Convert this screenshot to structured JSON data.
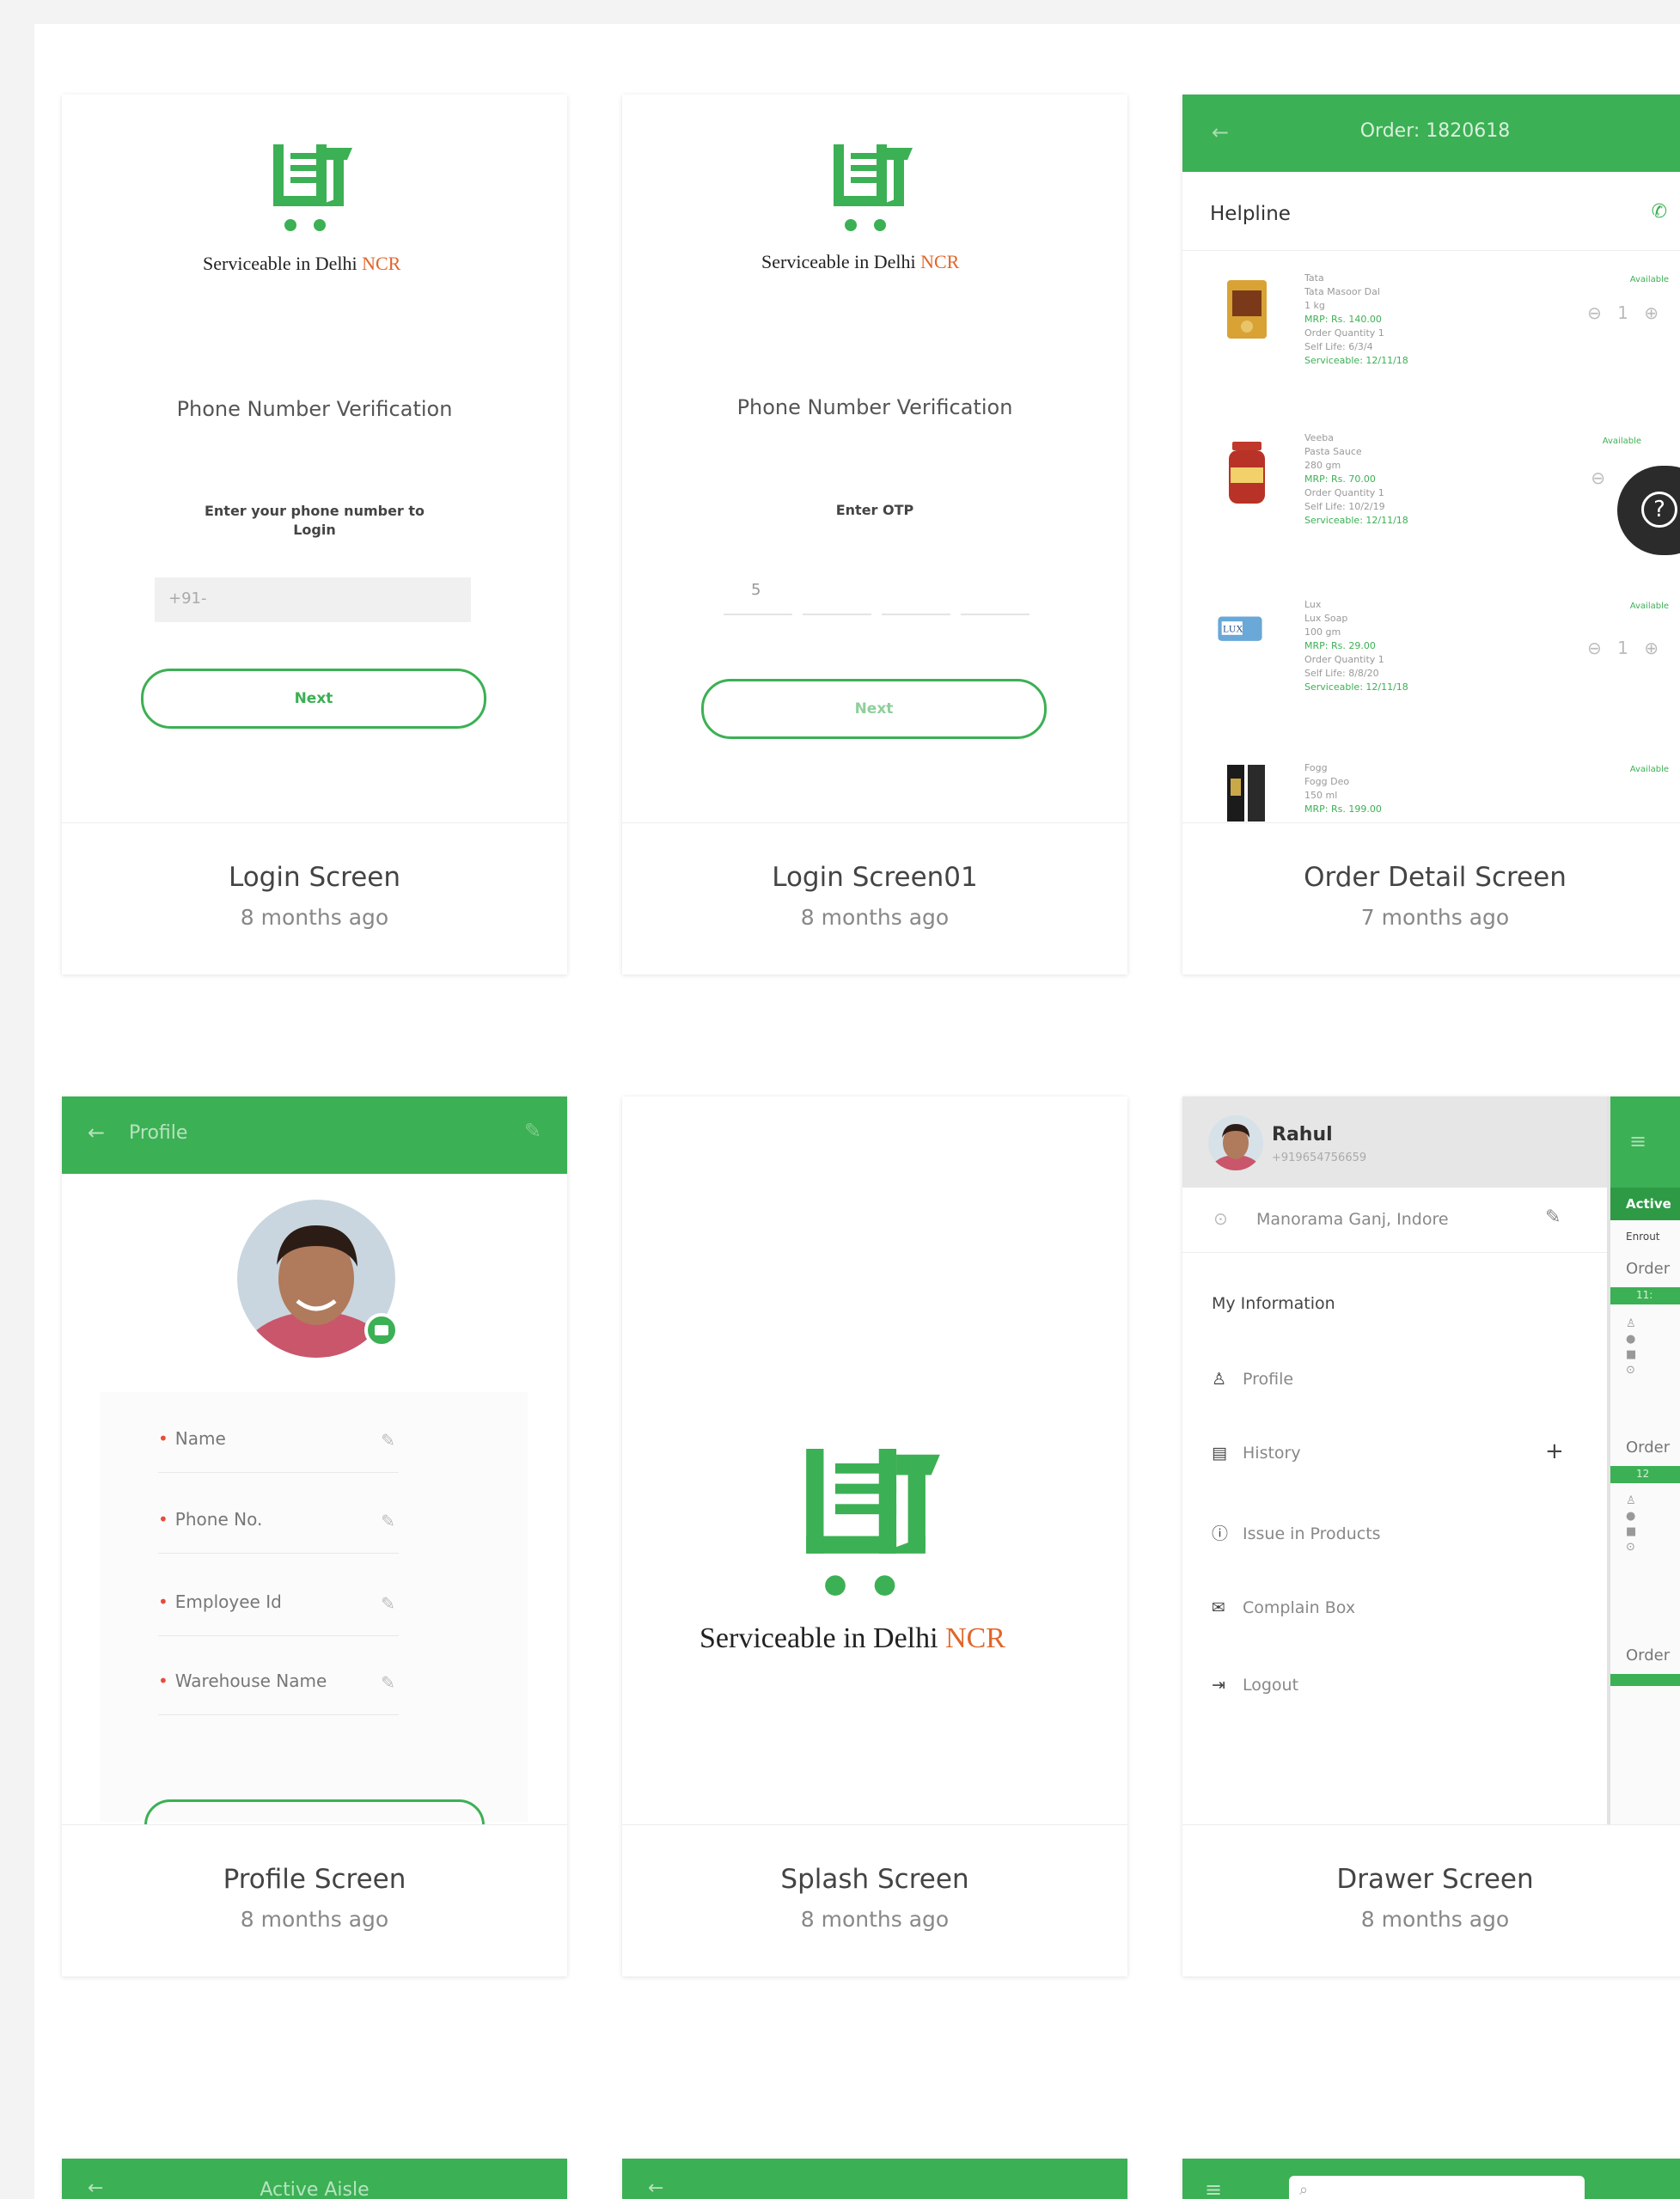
{
  "cards": [
    {
      "title": "Login Screen",
      "time": "8 months ago",
      "screen": {
        "brand_prefix": "Serviceable in Delhi ",
        "brand_highlight": "NCR",
        "heading": "Phone Number Verification",
        "instruction_line1": "Enter your phone number to",
        "instruction_line2": "Login",
        "input_value": "+91-",
        "button_label": "Next"
      }
    },
    {
      "title": "Login Screen01",
      "time": "8 months ago",
      "screen": {
        "brand_prefix": "Serviceable in Delhi ",
        "brand_highlight": "NCR",
        "heading": "Phone Number Verification",
        "instruction": "Enter OTP",
        "otp_first": "5",
        "button_label": "Next"
      }
    },
    {
      "title": "Order Detail Screen",
      "time": "7 months ago",
      "screen": {
        "appbar_title": "Order: 1820618",
        "helpline_label": "Helpline",
        "products": [
          {
            "brand": "Tata",
            "name": "Tata Masoor Dal",
            "size": "1 kg",
            "mrp": "MRP: Rs. 140.00",
            "qty": "Order Quantity 1",
            "self_life": "Self Life: 6/3/4",
            "serv": "Serviceable: 12/11/18",
            "status": "Available",
            "stepper": "⊖ 1 ⊕"
          },
          {
            "brand": "Veeba",
            "name": "Pasta Sauce",
            "size": "280 gm",
            "mrp": "MRP: Rs. 70.00",
            "qty": "Order Quantity 1",
            "self_life": "Self Life: 10/2/19",
            "serv": "Serviceable: 12/11/18",
            "status": "Available",
            "stepper": "⊖"
          },
          {
            "brand": "Lux",
            "name": "Lux Soap",
            "size": "100 gm",
            "mrp": "MRP: Rs. 29.00",
            "qty": "Order Quantity 1",
            "self_life": "Self Life: 8/8/20",
            "serv": "Serviceable: 12/11/18",
            "status": "Available",
            "stepper": "⊖ 1 ⊕"
          },
          {
            "brand": "Fogg",
            "name": "Fogg Deo",
            "size": "150 ml",
            "mrp": "MRP: Rs. 199.00",
            "qty": "",
            "self_life": "",
            "serv": "",
            "status": "Available",
            "stepper": ""
          }
        ],
        "help_glyph": "?"
      }
    },
    {
      "title": "Profile Screen",
      "time": "8 months ago",
      "screen": {
        "appbar_title": "Profile",
        "fields": [
          "Name",
          "Phone No.",
          "Employee Id",
          "Warehouse Name"
        ]
      }
    },
    {
      "title": "Splash Screen",
      "time": "8 months ago",
      "screen": {
        "brand_prefix": "Serviceable in Delhi ",
        "brand_highlight": "NCR"
      }
    },
    {
      "title": "Drawer Screen",
      "time": "8 months ago",
      "screen": {
        "user_name": "Rahul",
        "user_phone": "+919654756659",
        "location": "Manorama Ganj, Indore",
        "section_title": "My Information",
        "menu": [
          {
            "label": "Profile",
            "icon": "person-icon"
          },
          {
            "label": "History",
            "icon": "history-icon"
          },
          {
            "label": "Issue in Products",
            "icon": "info-icon"
          },
          {
            "label": "Complain Box",
            "icon": "mail-icon"
          },
          {
            "label": "Logout",
            "icon": "logout-icon"
          }
        ],
        "plus": "+",
        "side_tab": "Active",
        "side_enroute": "Enrout",
        "side_order1": "Order",
        "side_time1": "11:",
        "side_order2": "Order",
        "side_time2": "12",
        "side_order3": "Order"
      }
    }
  ],
  "bottom_row": {
    "card1_title": "Active Aisle"
  },
  "colors": {
    "brand_green": "#3cb054",
    "brand_orange": "#e0662a"
  }
}
